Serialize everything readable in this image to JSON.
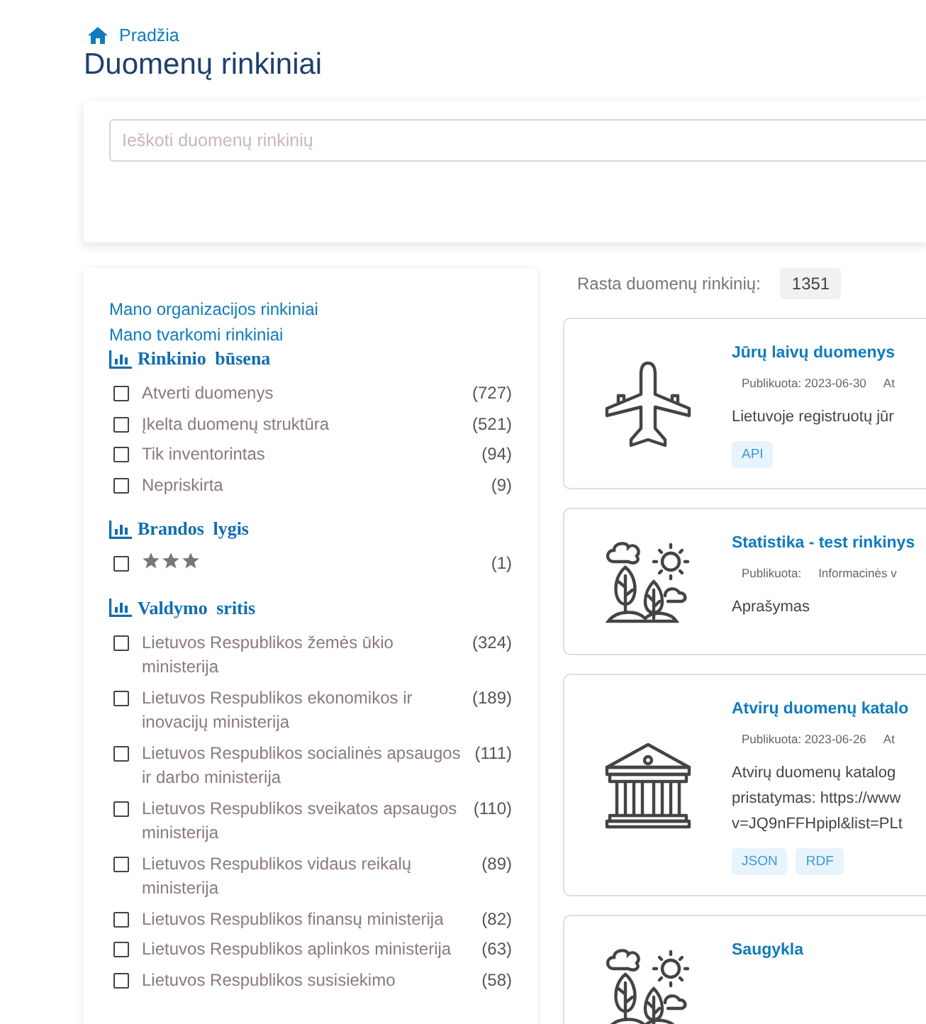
{
  "breadcrumb": {
    "label": "Pradžia"
  },
  "title": "Duomenų rinkiniai",
  "search": {
    "placeholder": "Ieškoti duomenų rinkinių"
  },
  "sidebar": {
    "links": [
      "Mano organizacijos rinkiniai",
      "Mano tvarkomi rinkiniai"
    ],
    "filters": [
      {
        "heading": "Rinkinio būsena",
        "items": [
          {
            "kind": "text",
            "label": "Atverti duomenys",
            "count": "(727)",
            "checked": false
          },
          {
            "kind": "text",
            "label": "Įkelta duomenų struktūra",
            "count": "(521)",
            "checked": false
          },
          {
            "kind": "text",
            "label": "Tik inventorintas",
            "count": "(94)",
            "checked": false
          },
          {
            "kind": "text",
            "label": "Nepriskirta",
            "count": "(9)",
            "checked": false
          }
        ]
      },
      {
        "heading": "Brandos lygis",
        "items": [
          {
            "kind": "stars",
            "stars": 3,
            "count": "(1)",
            "checked": false
          }
        ]
      },
      {
        "heading": "Valdymo sritis",
        "items": [
          {
            "kind": "text",
            "label": "Lietuvos Respublikos žemės ūkio ministerija",
            "count": "(324)",
            "checked": false
          },
          {
            "kind": "text",
            "label": "Lietuvos Respublikos ekonomikos ir inovacijų ministerija",
            "count": "(189)",
            "checked": false
          },
          {
            "kind": "text",
            "label": "Lietuvos Respublikos socialinės apsaugos ir darbo ministerija",
            "count": "(111)",
            "checked": false
          },
          {
            "kind": "text",
            "label": "Lietuvos Respublikos sveikatos apsaugos ministerija",
            "count": "(110)",
            "checked": false
          },
          {
            "kind": "text",
            "label": "Lietuvos Respublikos vidaus reikalų ministerija",
            "count": "(89)",
            "checked": false
          },
          {
            "kind": "text",
            "label": "Lietuvos Respublikos finansų ministerija",
            "count": "(82)",
            "checked": false
          },
          {
            "kind": "text",
            "label": "Lietuvos Respublikos aplinkos ministerija",
            "count": "(63)",
            "checked": false
          },
          {
            "kind": "text",
            "label": "Lietuvos Respublikos susisiekimo",
            "count": "(58)",
            "checked": false
          }
        ]
      }
    ]
  },
  "results": {
    "label": "Rasta duomenų rinkinių:",
    "count": "1351",
    "cards": [
      {
        "title": "Jūrų laivų duomenys",
        "meta": [
          "Publikuota: 2023-06-30",
          "At"
        ],
        "description": [
          "Lietuvoje registruotų jūr"
        ],
        "tags": [
          "API"
        ]
      },
      {
        "title": "Statistika - test rinkinys",
        "meta": [
          "Publikuota:",
          "Informacinės v"
        ],
        "description": [
          "Aprašymas"
        ]
      },
      {
        "title": "Atvirų duomenų katalo",
        "meta": [
          "Publikuota: 2023-06-26",
          "At"
        ],
        "description": [
          "Atvirų duomenų katalog",
          "pristatymas: https://www",
          "v=JQ9nFFHpipl&list=PLt"
        ],
        "tags": [
          "JSON",
          "RDF"
        ]
      },
      {
        "title": "Saugykla"
      }
    ]
  }
}
